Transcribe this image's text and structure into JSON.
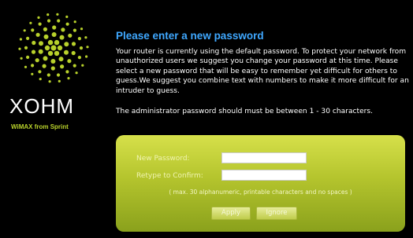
{
  "brand": {
    "name": "XOHM",
    "tagline": "WiMAX from Sprint",
    "logo_color": "#b8d12b"
  },
  "page": {
    "title": "Please enter a new password",
    "description": "Your router is currently using the default password. To protect your network from unauthorized users we suggest you change your password at this time. Please select a new password that will be easy to remember yet difficult for others to guess.We suggest you combine text with numbers to make it more difficult for an intruder to guess.",
    "note": "The administrator password should must be between 1 - 30 characters.",
    "title_color": "#3fa8ff"
  },
  "form": {
    "new_password_label": "New Password:",
    "new_password_value": "",
    "confirm_label": "Retype to Confirm:",
    "confirm_value": "",
    "hint": "( max. 30 alphanumeric, printable characters and no spaces )",
    "apply_label": "Apply",
    "ignore_label": "Ignore",
    "panel_color": "#b4c42d"
  }
}
